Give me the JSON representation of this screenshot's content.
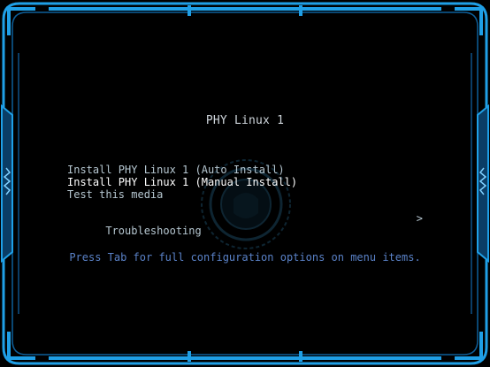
{
  "title": "PHY Linux 1",
  "menu": {
    "items": [
      {
        "label": "Install PHY Linux 1 (Auto Install)",
        "selected": false
      },
      {
        "label": "Install PHY Linux 1 (Manual Install)",
        "selected": true
      },
      {
        "label": "Test this media",
        "selected": false
      }
    ],
    "troubleshooting": {
      "label": "Troubleshooting",
      "arrow": ">"
    }
  },
  "hint": "Press Tab for full configuration options on menu items.",
  "colors": {
    "frame": "#1f9fe6",
    "frame_dark": "#0a3d66",
    "title": "#cfd6dc",
    "item": "#b6c7d1",
    "selected": "#ffffff",
    "hint": "#5a82c8"
  }
}
